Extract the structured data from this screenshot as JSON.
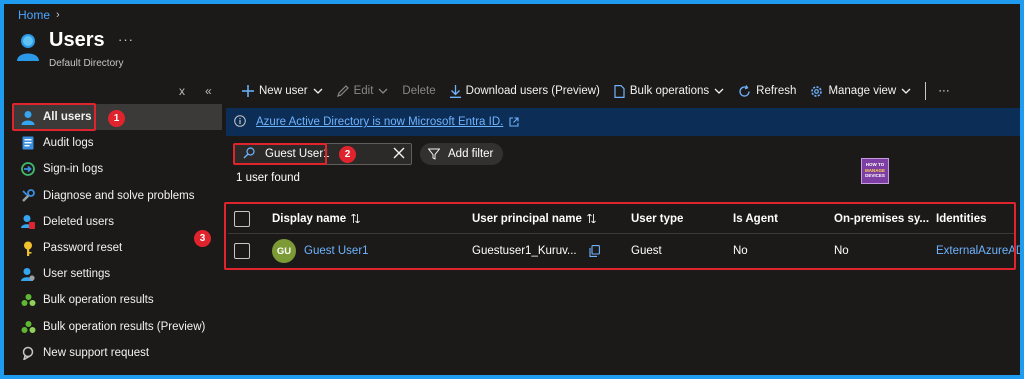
{
  "breadcrumb": {
    "home": "Home"
  },
  "header": {
    "title": "Users",
    "subtitle": "Default Directory",
    "more": "···"
  },
  "collapse": {
    "close": "x",
    "collapse": "«"
  },
  "sidebar": {
    "items": [
      {
        "label": "All users",
        "icon": "user-icon"
      },
      {
        "label": "Audit logs",
        "icon": "document-icon"
      },
      {
        "label": "Sign-in logs",
        "icon": "sign-in-icon"
      },
      {
        "label": "Diagnose and solve problems",
        "icon": "wrench-icon"
      },
      {
        "label": "Deleted users",
        "icon": "deleted-user-icon"
      },
      {
        "label": "Password reset",
        "icon": "key-icon"
      },
      {
        "label": "User settings",
        "icon": "user-settings-icon"
      },
      {
        "label": "Bulk operation results",
        "icon": "group-icon"
      },
      {
        "label": "Bulk operation results (Preview)",
        "icon": "group-icon"
      },
      {
        "label": "New support request",
        "icon": "support-icon"
      }
    ]
  },
  "toolbar": {
    "new_user": "New user",
    "edit": "Edit",
    "delete": "Delete",
    "download": "Download users (Preview)",
    "bulk": "Bulk operations",
    "refresh": "Refresh",
    "manage_view": "Manage view",
    "more": "···"
  },
  "banner": {
    "text": "Azure Active Directory is now Microsoft Entra ID."
  },
  "search": {
    "value": "Guest User1"
  },
  "filter": {
    "label": "Add filter"
  },
  "result_count": "1 user found",
  "logo": {
    "line1": "HOW TO",
    "line2": "MANAGE",
    "line3": "DEVICES"
  },
  "callouts": {
    "one": "1",
    "two": "2",
    "three": "3"
  },
  "table": {
    "headers": [
      "Display name",
      "User principal name",
      "User type",
      "Is Agent",
      "On-premises sy...",
      "Identities"
    ],
    "rows": [
      {
        "initials": "GU",
        "display_name": "Guest User1",
        "upn": "Guestuser1_Kuruv...",
        "user_type": "Guest",
        "is_agent": "No",
        "on_prem": "No",
        "identities": "ExternalAzureAD"
      }
    ]
  },
  "colors": {
    "accent": "#1f9bf0",
    "annotation": "#e0242d",
    "link": "#6fb3ff",
    "avatar": "#7c9a36"
  }
}
